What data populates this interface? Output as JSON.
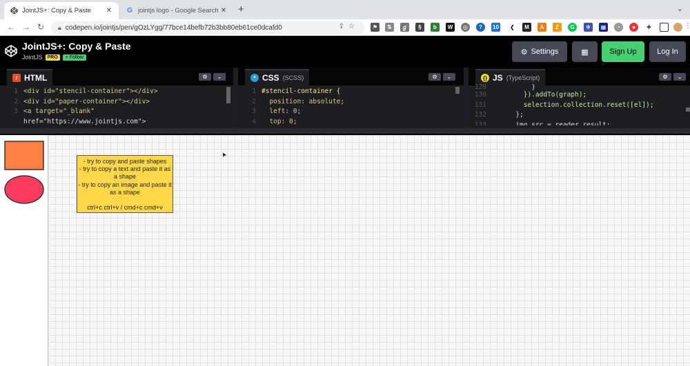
{
  "browser": {
    "tabs": [
      {
        "title": "JointJS+: Copy & Paste",
        "active": true
      },
      {
        "title": "jointjs logo - Google Search",
        "active": false
      }
    ],
    "url": "codepen.io/jointjs/pen/gOzLYgg/77bce14befb72b3bb80eb61ce0dcafd0"
  },
  "codepen": {
    "title": "JointJS+: Copy & Paste",
    "author": "JointJS",
    "pro_badge": "PRO",
    "follow_label": "+ Follow",
    "settings_label": "Settings",
    "signup_label": "Sign Up",
    "login_label": "Log In"
  },
  "editors": {
    "html": {
      "label": "HTML",
      "lines": [
        {
          "n": "1",
          "code": "<div id=\"stencil-container\"></div>"
        },
        {
          "n": "2",
          "code": "<div id=\"paper-container\"></div>"
        },
        {
          "n": "3",
          "code": "<a target=\"_blank\""
        },
        {
          "n": "",
          "code": "href=\"https://www.jointjs.com\">"
        }
      ]
    },
    "css": {
      "label": "CSS",
      "sublabel": "(SCSS)",
      "lines": [
        {
          "n": "1",
          "code": "#stencil-container {"
        },
        {
          "n": "2",
          "code": "  position: absolute;"
        },
        {
          "n": "3",
          "code": "  left: 0;"
        },
        {
          "n": "4",
          "code": "  top: 0;"
        }
      ]
    },
    "js": {
      "label": "JS",
      "sublabel": "(TypeScript)",
      "lines": [
        {
          "n": "129",
          "code": "          }"
        },
        {
          "n": "130",
          "code": "        }).addTo(graph);"
        },
        {
          "n": "131",
          "code": "        selection.collection.reset([el]);"
        },
        {
          "n": "132",
          "code": "      };"
        },
        {
          "n": "133",
          "code": "      img.src = reader.result;"
        }
      ]
    }
  },
  "preview": {
    "stencil_colors": {
      "rect": "#ff7f45",
      "ellipse": "#fe3a5f"
    },
    "note_lines": [
      "- try to copy and paste shapes",
      "- try to copy a text and paste it as a shape",
      "- try to copy an image and paste it as a shape",
      "",
      "ctrl+c ctrl+v / cmd+c cmd+v"
    ],
    "note_color": "#ffd84a"
  },
  "colors": {
    "codepen_green": "#47cf73",
    "codepen_button": "#444857",
    "pro_yellow": "#ffdd40"
  }
}
